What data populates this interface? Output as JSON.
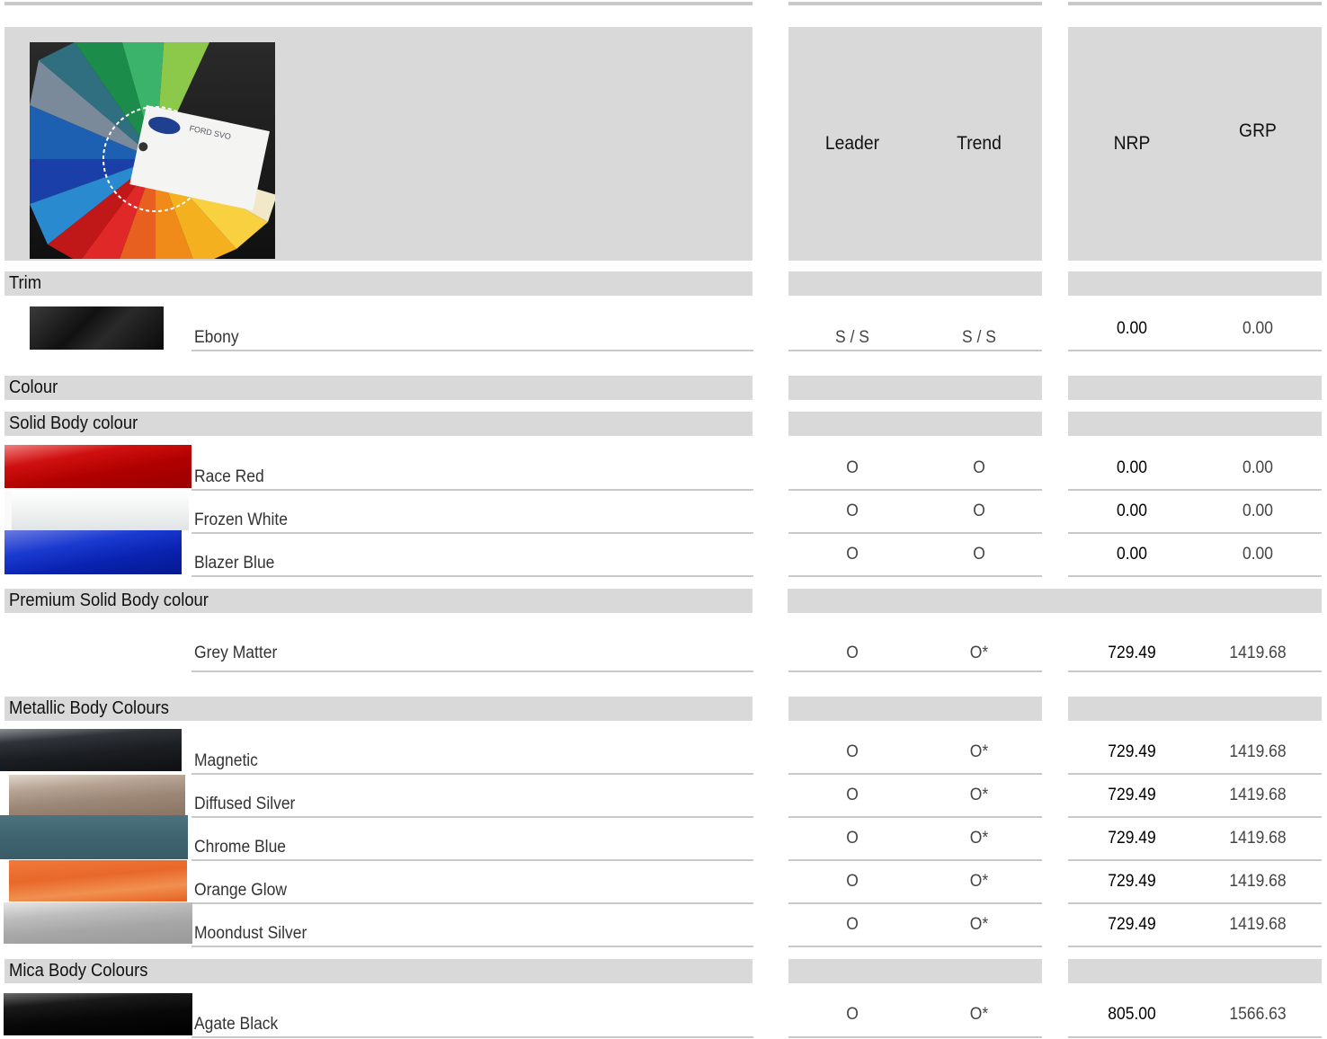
{
  "header": {
    "leader": "Leader",
    "trend": "Trend",
    "nrp": "NRP",
    "grp": "GRP"
  },
  "hero_image": {
    "icon": "paint-fan-deck-image",
    "card_text": "FORD SVO"
  },
  "sections": {
    "trim": "Trim",
    "colour": "Colour",
    "solid": "Solid Body colour",
    "premium": "Premium Solid Body colour",
    "metallic": "Metallic Body Colours",
    "mica": "Mica Body Colours"
  },
  "rows": {
    "ebony": {
      "name": "Ebony",
      "leader": "S / S",
      "trend": "S / S",
      "nrp": "0.00",
      "grp": "0.00",
      "swatch_color": "#1a1a1a"
    },
    "race_red": {
      "name": "Race Red",
      "leader": "O",
      "trend": "O",
      "nrp": "0.00",
      "grp": "0.00",
      "swatch_color": "#b70000"
    },
    "frozen_white": {
      "name": "Frozen White",
      "leader": "O",
      "trend": "O",
      "nrp": "0.00",
      "grp": "0.00",
      "swatch_color": "#f0f2f2"
    },
    "blazer_blue": {
      "name": "Blazer Blue",
      "leader": "O",
      "trend": "O",
      "nrp": "0.00",
      "grp": "0.00",
      "swatch_color": "#1230b8"
    },
    "grey_matter": {
      "name": "Grey Matter",
      "leader": "O",
      "trend": "O*",
      "nrp": "729.49",
      "grp": "1419.68"
    },
    "magnetic": {
      "name": "Magnetic",
      "leader": "O",
      "trend": "O*",
      "nrp": "729.49",
      "grp": "1419.68",
      "swatch_color": "#1b1e22"
    },
    "diffused_silver": {
      "name": "Diffused Silver",
      "leader": "O",
      "trend": "O*",
      "nrp": "729.49",
      "grp": "1419.68",
      "swatch_color": "#9c8777"
    },
    "chrome_blue": {
      "name": "Chrome Blue",
      "leader": "O",
      "trend": "O*",
      "nrp": "729.49",
      "grp": "1419.68",
      "swatch_color": "#3f6470"
    },
    "orange_glow": {
      "name": "Orange Glow",
      "leader": "O",
      "trend": "O*",
      "nrp": "729.49",
      "grp": "1419.68",
      "swatch_color": "#e8682a"
    },
    "moondust_silver": {
      "name": "Moondust Silver",
      "leader": "O",
      "trend": "O*",
      "nrp": "729.49",
      "grp": "1419.68",
      "swatch_color": "#a6a6a6"
    },
    "agate_black": {
      "name": "Agate Black",
      "leader": "O",
      "trend": "O*",
      "nrp": "805.00",
      "grp": "1566.63",
      "swatch_color": "#080808"
    }
  }
}
